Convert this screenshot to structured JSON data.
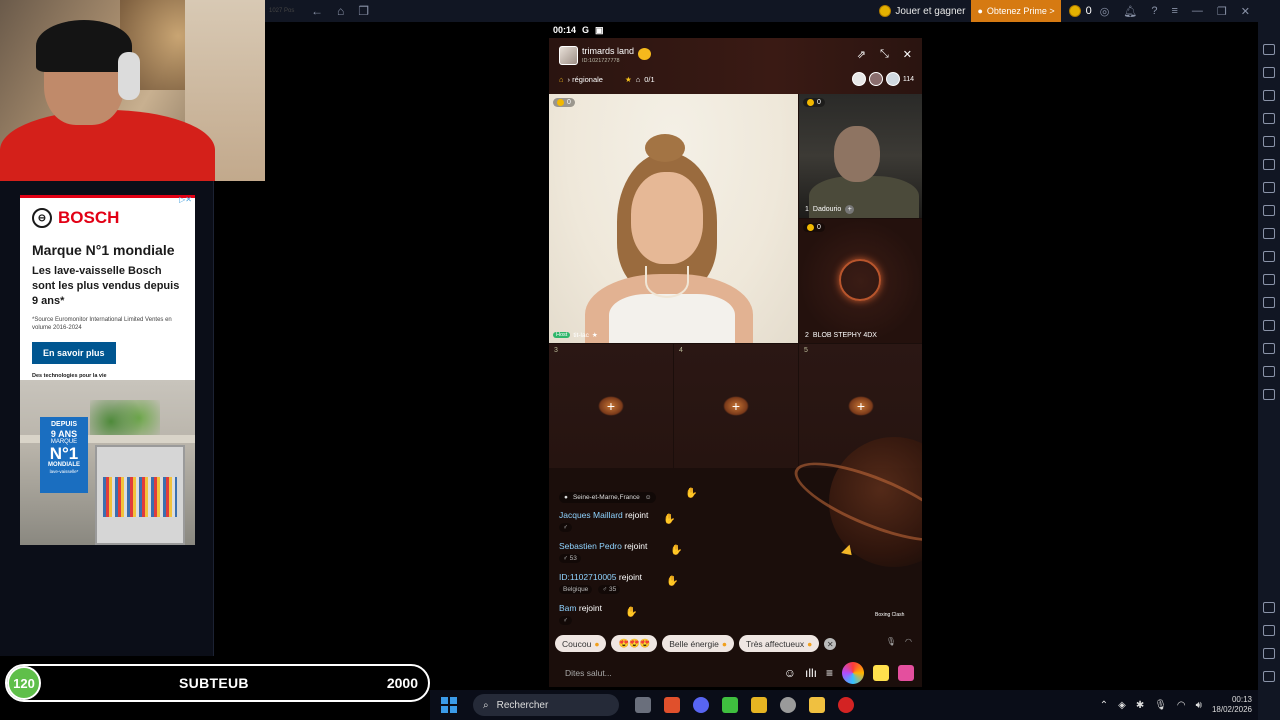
{
  "topbar": {
    "ghost_text": "1027 Pos",
    "play_earn": "Jouer et gagner",
    "prime": "Obtenez Prime >",
    "coins": "0"
  },
  "ad": {
    "brand": "BOSCH",
    "adchoices": "▷✕",
    "headline": "Marque N°1 mondiale",
    "subheadline": "Les lave-vaisselle Bosch sont les plus vendus depuis 9 ans*",
    "source": "*Source Euromonitor International Limited Ventes en volume 2016-2024",
    "cta": "En savoir plus",
    "tagline": "Des technologies pour la vie",
    "badge_line1": "DEPUIS",
    "badge_line2": "9 ANS",
    "badge_line3": "MARQUE",
    "badge_line4": "N°1",
    "badge_line5": "MONDIALE",
    "badge_line6": "lave-vaisselle*"
  },
  "subgoal": {
    "current": "120",
    "label": "SUBTEUB",
    "goal": "2000",
    "progress_fraction": 0.06,
    "accent": "#5fbf4a"
  },
  "phone": {
    "time": "00:14",
    "room": {
      "name": "trimards land",
      "id": "ID:1021727778",
      "tag": "› régionale",
      "seats": "0/1",
      "viewers": "114"
    },
    "host": {
      "coins": "0",
      "badge": "Host",
      "name": "tit-lac"
    },
    "tiles": [
      {
        "num": "1",
        "name": "Dadourio",
        "coins": "0"
      },
      {
        "num": "2",
        "name": "BLOB STEPHY 4DX",
        "coins": "0"
      }
    ],
    "empty_seats": [
      "3",
      "4",
      "5"
    ],
    "chat": {
      "location": "Seine-et-Marne,France",
      "messages": [
        {
          "name": "Jacques Maillard",
          "action": "rejoint",
          "meta": "♂"
        },
        {
          "name": "Sebastien Pedro",
          "action": "rejoint",
          "meta": "♂ 53"
        },
        {
          "name": "ID:1102710005",
          "action": "rejoint",
          "meta": "Belgique",
          "meta2": "♂ 35"
        },
        {
          "name": "Bam",
          "action": "rejoint",
          "meta": "♂"
        }
      ]
    },
    "boxing": "Boxing Clash",
    "quick_replies": [
      "Coucou",
      "😍😍😍",
      "Belle énergie",
      "Très affectueux"
    ],
    "input_placeholder": "Dites salut..."
  },
  "taskbar": {
    "search": "Rechercher",
    "time": "00:13",
    "date": "18/02/2026"
  }
}
